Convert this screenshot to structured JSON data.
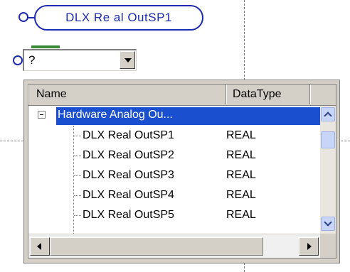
{
  "tag": {
    "label": "DLX Re al OutSP1"
  },
  "combo": {
    "value": "?"
  },
  "list": {
    "columns": [
      "Name",
      "DataType"
    ],
    "group": {
      "label": "Hardware Analog Ou...",
      "type": ""
    },
    "rows": [
      {
        "name": "DLX Real OutSP1",
        "type": "REAL"
      },
      {
        "name": "DLX Real OutSP2",
        "type": "REAL"
      },
      {
        "name": "DLX Real OutSP3",
        "type": "REAL"
      },
      {
        "name": "DLX Real OutSP4",
        "type": "REAL"
      },
      {
        "name": "DLX Real OutSP5",
        "type": "REAL"
      }
    ]
  },
  "colors": {
    "accent": "#1d2bb0",
    "selection": "#1a4fd0"
  }
}
